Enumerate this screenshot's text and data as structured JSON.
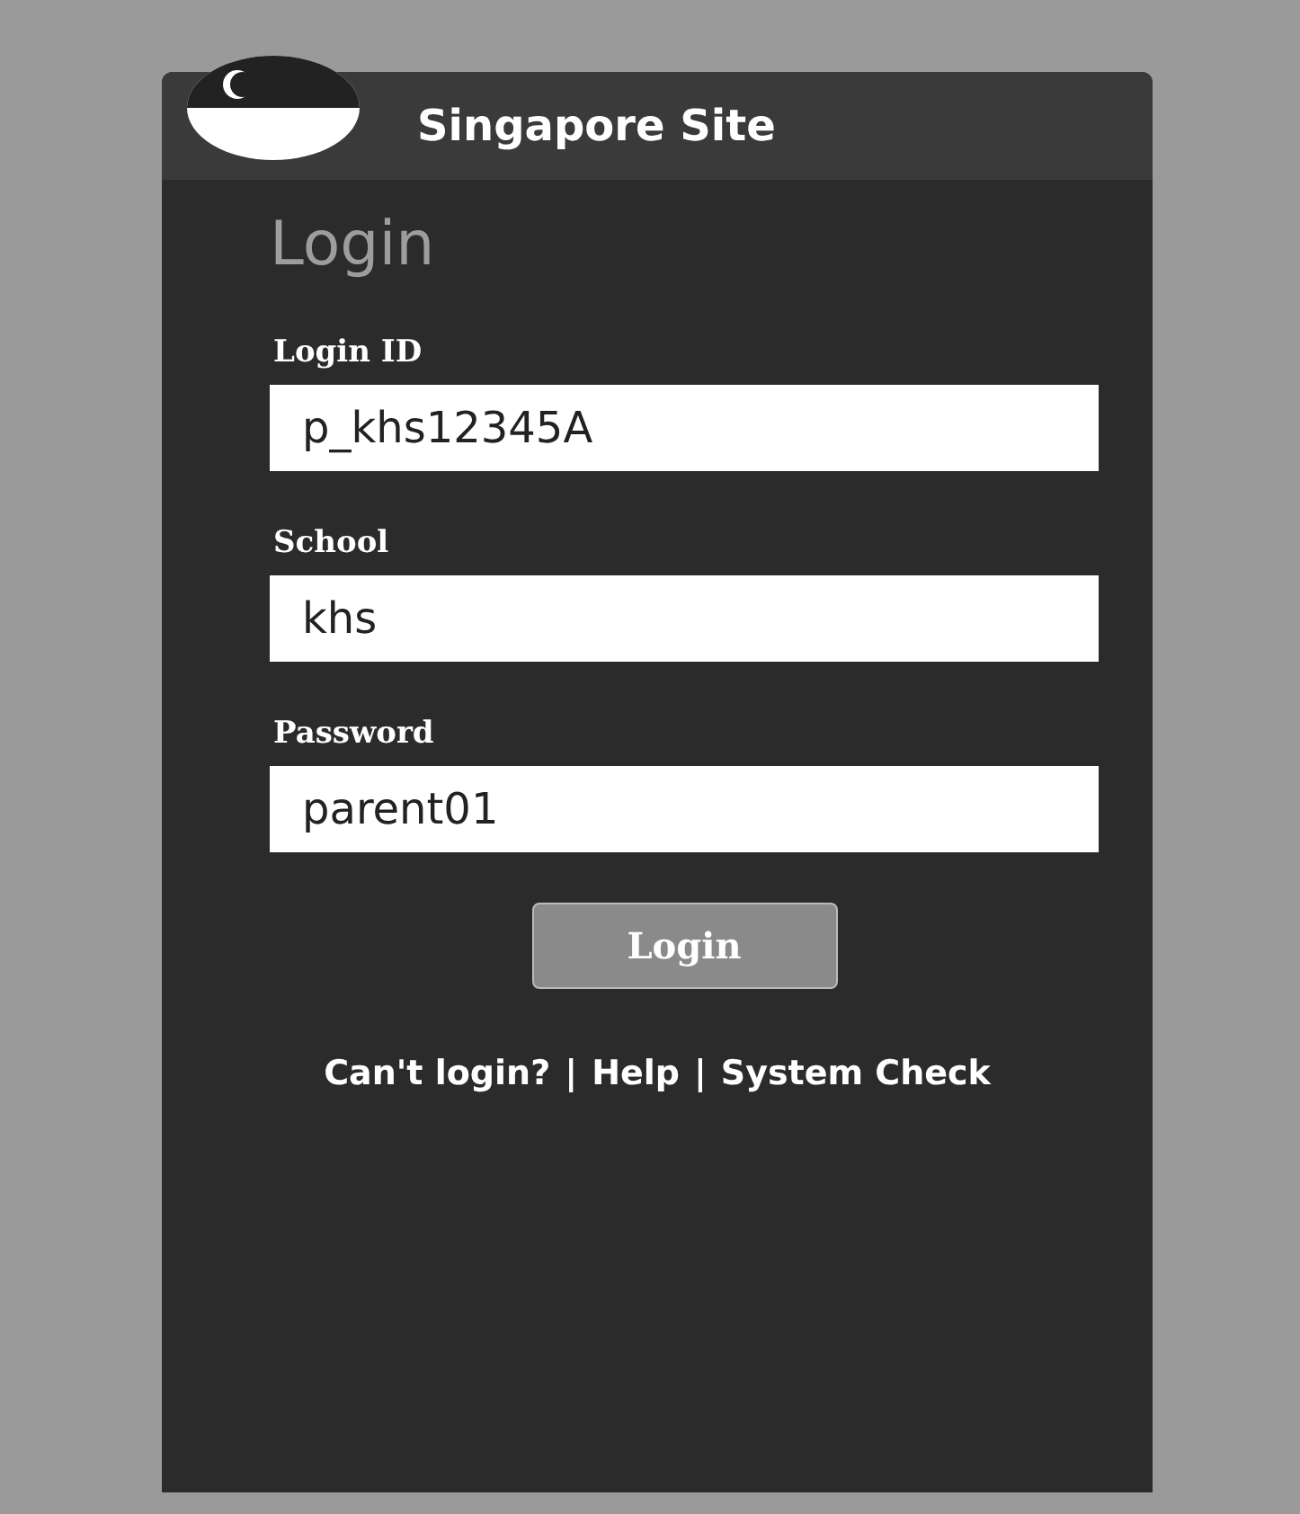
{
  "header": {
    "title": "Singapore Site"
  },
  "heading": "Login",
  "fields": [
    {
      "label": "Login ID",
      "value": "p_khs12345A"
    },
    {
      "label": "School",
      "value": "khs"
    },
    {
      "label": "Password",
      "value": "parent01"
    }
  ],
  "login_button": "Login",
  "links": [
    {
      "label": "Can't login?"
    },
    {
      "label": "Help"
    },
    {
      "label": "System Check"
    }
  ],
  "separator": "|"
}
